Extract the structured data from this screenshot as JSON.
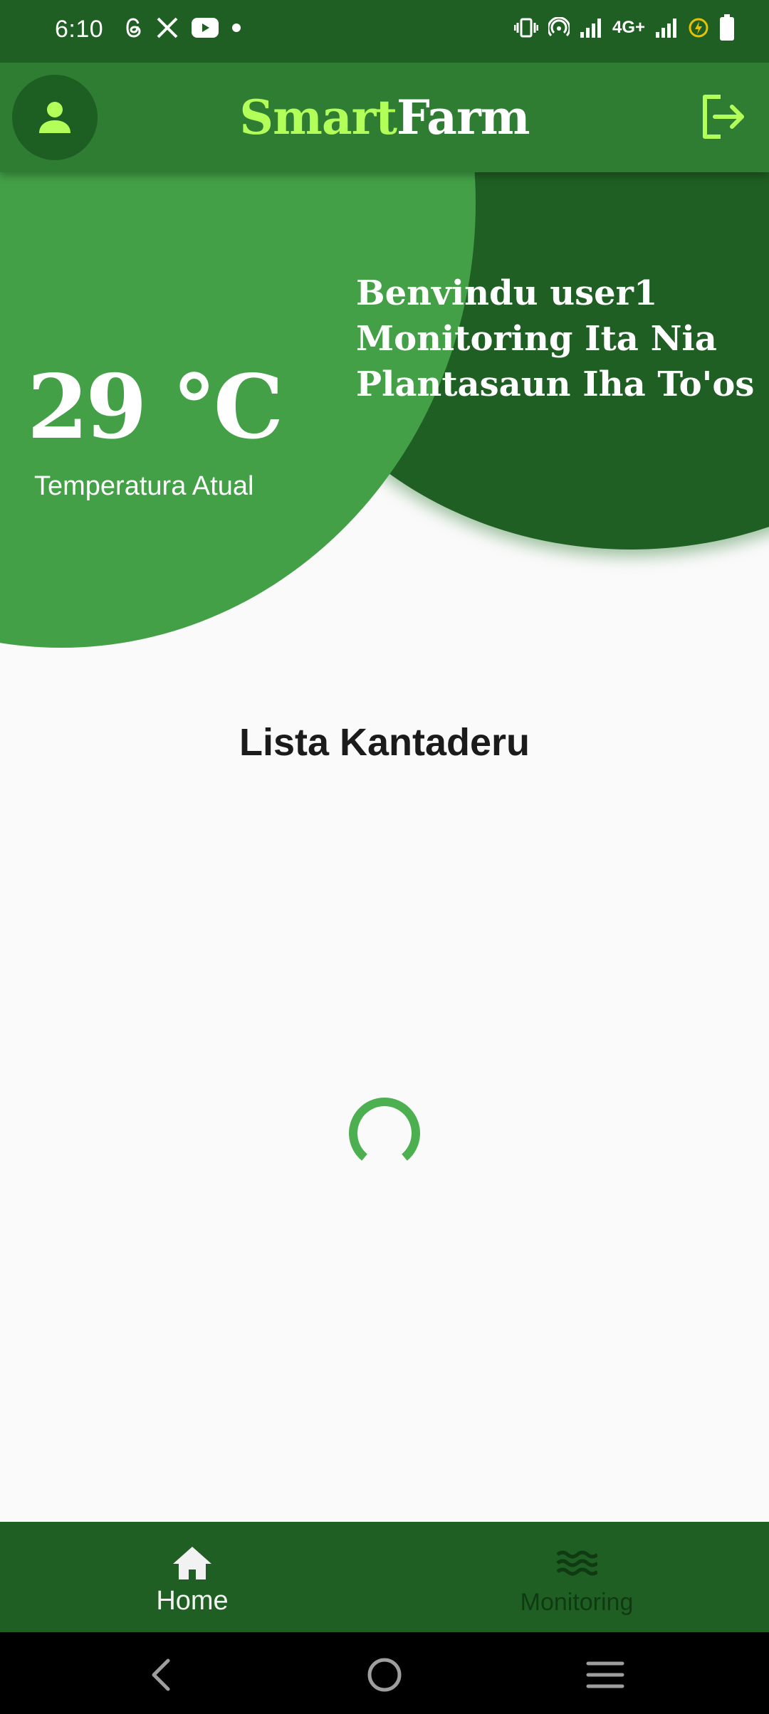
{
  "status_bar": {
    "time": "6:10",
    "network": "4G+",
    "left_icons": [
      "threads-icon",
      "x-icon",
      "youtube-icon",
      "dot-icon"
    ],
    "right_icons": [
      "vibrate-icon",
      "hotspot-icon",
      "signal-icon",
      "signal-icon",
      "battery-saver-icon",
      "battery-icon"
    ]
  },
  "app_bar": {
    "title_part1": "Smart",
    "title_part2": "Farm",
    "profile_icon": "person-icon",
    "logout_icon": "logout-icon"
  },
  "header": {
    "temperature": "29 °C",
    "temperature_label": "Temperatura Atual",
    "welcome_line1": "Benvindu user1",
    "welcome_line2": "Monitoring Ita Nia",
    "welcome_line3": "Plantasaun Iha To'os"
  },
  "content": {
    "section_title": "Lista Kantaderu"
  },
  "bottom_nav": {
    "items": [
      {
        "label": "Home",
        "icon": "home-icon",
        "active": true
      },
      {
        "label": "Monitoring",
        "icon": "waves-icon",
        "active": false
      }
    ]
  },
  "colors": {
    "primary": "#2e7d32",
    "primary_dark": "#1f5f23",
    "circle_light": "#43a047",
    "accent": "#b2ff59",
    "background": "#fafafa",
    "spinner": "#4caf50"
  }
}
